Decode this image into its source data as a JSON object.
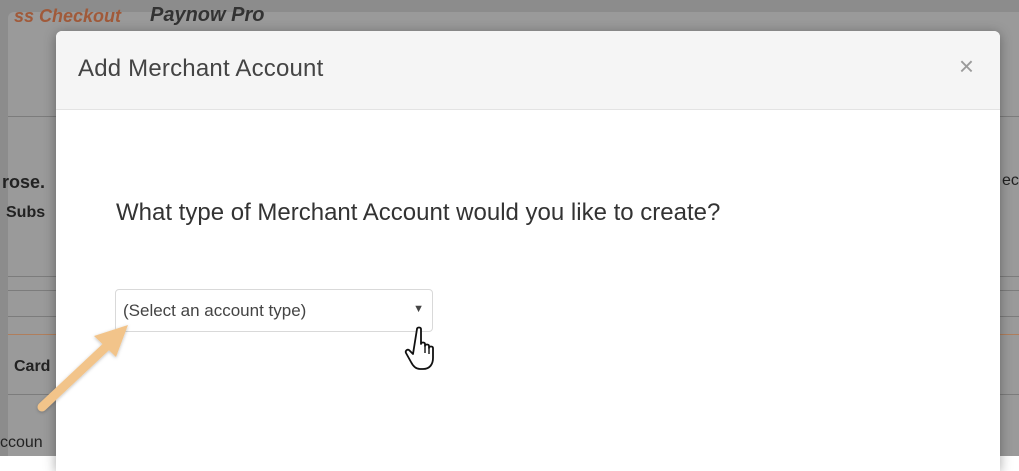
{
  "background": {
    "top_left_text": "ss Checkout",
    "top_right_text": "Paynow Pro",
    "left_line1": "rose.",
    "left_line2": "Subs",
    "left_card": "Card",
    "left_account": "ccoun",
    "right_edge": "ect"
  },
  "modal": {
    "title": "Add Merchant Account",
    "close_symbol": "×",
    "question": "What type of Merchant Account would you like to create?",
    "select": {
      "value": "(Select an account type)",
      "caret": "▼"
    }
  },
  "colors": {
    "annotation_arrow": "#f2c48a",
    "modal_header_bg": "#f5f5f5"
  }
}
